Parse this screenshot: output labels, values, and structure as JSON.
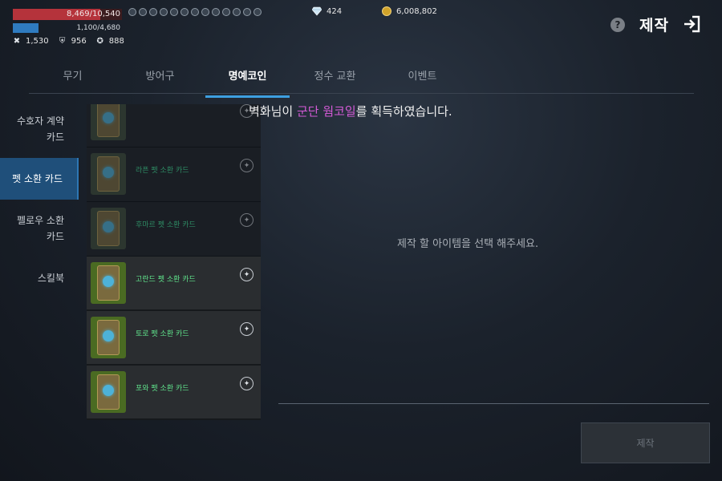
{
  "status": {
    "hp_text": "8,469/10,540",
    "hp_fraction": 0.8,
    "mp_text": "1,100/4,680",
    "mp_fraction": 0.235,
    "stats": [
      {
        "icon": "crossed-swords-icon",
        "glyph": "✖",
        "value": "1,530"
      },
      {
        "icon": "shield-icon",
        "glyph": "⛨",
        "value": "956"
      },
      {
        "icon": "emblem-icon",
        "glyph": "✪",
        "value": "888"
      }
    ],
    "buff_count": 13,
    "diamond": "424",
    "gold": "6,008,802",
    "colors": {
      "hp": "#b5333b",
      "mp": "#2f7bc0",
      "accent": "#3d9fe0"
    }
  },
  "header": {
    "help_glyph": "?",
    "title": "제작"
  },
  "tabs": [
    {
      "label": "무기",
      "active": false
    },
    {
      "label": "방어구",
      "active": false
    },
    {
      "label": "명예코인",
      "active": true
    },
    {
      "label": "정수 교환",
      "active": false
    },
    {
      "label": "이벤트",
      "active": false
    }
  ],
  "categories": [
    {
      "line1": "수호자 계약",
      "line2": "카드",
      "active": false
    },
    {
      "line1": "펫 소환 카드",
      "line2": "",
      "active": true
    },
    {
      "line1": "펠로우 소환",
      "line2": "카드",
      "active": false
    },
    {
      "line1": "스킬북",
      "line2": "",
      "active": false
    }
  ],
  "cards": [
    {
      "name": "",
      "owned": false
    },
    {
      "name": "라픈 펫 소환 카드",
      "owned": false
    },
    {
      "name": "후마르 펫 소환 카드",
      "owned": false
    },
    {
      "name": "고란드 펫 소환 카드",
      "owned": true
    },
    {
      "name": "토로 펫 소환 카드",
      "owned": true
    },
    {
      "name": "포와 펫 소환 카드",
      "owned": true
    }
  ],
  "notice": {
    "prefix": "벽화님이 ",
    "highlight": "군단 웜코일",
    "suffix": "를 획득하였습니다."
  },
  "empty_message": "제작 할 아이템을 선택 해주세요.",
  "craft_button": "제작"
}
